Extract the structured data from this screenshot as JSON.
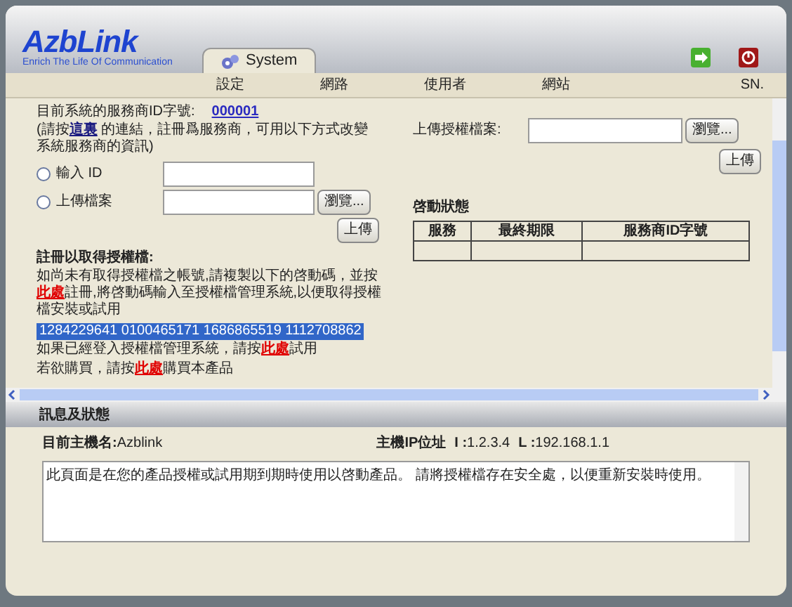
{
  "logo": {
    "name": "AzbLink",
    "tagline": "Enrich The Life Of Communication"
  },
  "tabs": [
    {
      "label": "System",
      "selected": true
    }
  ],
  "menu": [
    {
      "label": "設定"
    },
    {
      "label": "網路"
    },
    {
      "label": "使用者"
    },
    {
      "label": "網站"
    },
    {
      "label": "SN."
    }
  ],
  "provider": {
    "id_label": "目前系統的服務商ID字號:",
    "id_value": "000001",
    "note": [
      {
        "kind": "text",
        "text": "(請按"
      },
      {
        "kind": "link",
        "text": "這裏"
      },
      {
        "kind": "text",
        "text": " 的連結，註冊爲服務商，可用以下方式改變系統服務商的資訊)"
      }
    ],
    "options": [
      {
        "label": "輸入 ID",
        "selected": false,
        "kind": "id"
      },
      {
        "label": "上傳檔案",
        "selected": false,
        "kind": "file"
      }
    ],
    "browse_button": "瀏覽...",
    "upload_button": "上傳"
  },
  "register": {
    "title": "註冊以取得授權檔:",
    "paragraph": [
      {
        "kind": "text",
        "text": "如尚未有取得授權檔之帳號,請複製以下的啓動碼，並按"
      },
      {
        "kind": "link",
        "text": "此處"
      },
      {
        "kind": "text",
        "text": "註冊,將啓動碼輸入至授權檔管理系統,以便取得授權檔安裝或試用"
      }
    ],
    "activation_code": {
      "text": "1284229641 0100465171 1686865519 1112708862",
      "highlighted": true
    },
    "trial": [
      {
        "kind": "text",
        "text": "如果已經登入授權檔管理系統，請按"
      },
      {
        "kind": "link",
        "text": "此處"
      },
      {
        "kind": "text",
        "text": "試用"
      }
    ],
    "buy": [
      {
        "kind": "text",
        "text": "若欲購買，請按"
      },
      {
        "kind": "link",
        "text": "此處"
      },
      {
        "kind": "text",
        "text": "購買本產品"
      }
    ]
  },
  "license_upload": {
    "label": "上傳授權檔案:",
    "browse_button": "瀏覽...",
    "upload_button": "上傳"
  },
  "activation_status": {
    "title": "啓動狀態",
    "columns": [
      "服務",
      "最終期限",
      "服務商ID字號"
    ]
  },
  "status_panel": {
    "title": "訊息及狀態",
    "host_label": "目前主機名:",
    "host_value": "Azblink",
    "ip_label": "主機IP位址",
    "ip_i_label": "I :",
    "ip_i_value": "1.2.3.4",
    "ip_l_label": "L :",
    "ip_l_value": "192.168.1.1",
    "message": "此頁面是在您的產品授權或試用期到期時使用以啓動產品。 請將授權檔存在安全處，以便重新安裝時使用。"
  }
}
